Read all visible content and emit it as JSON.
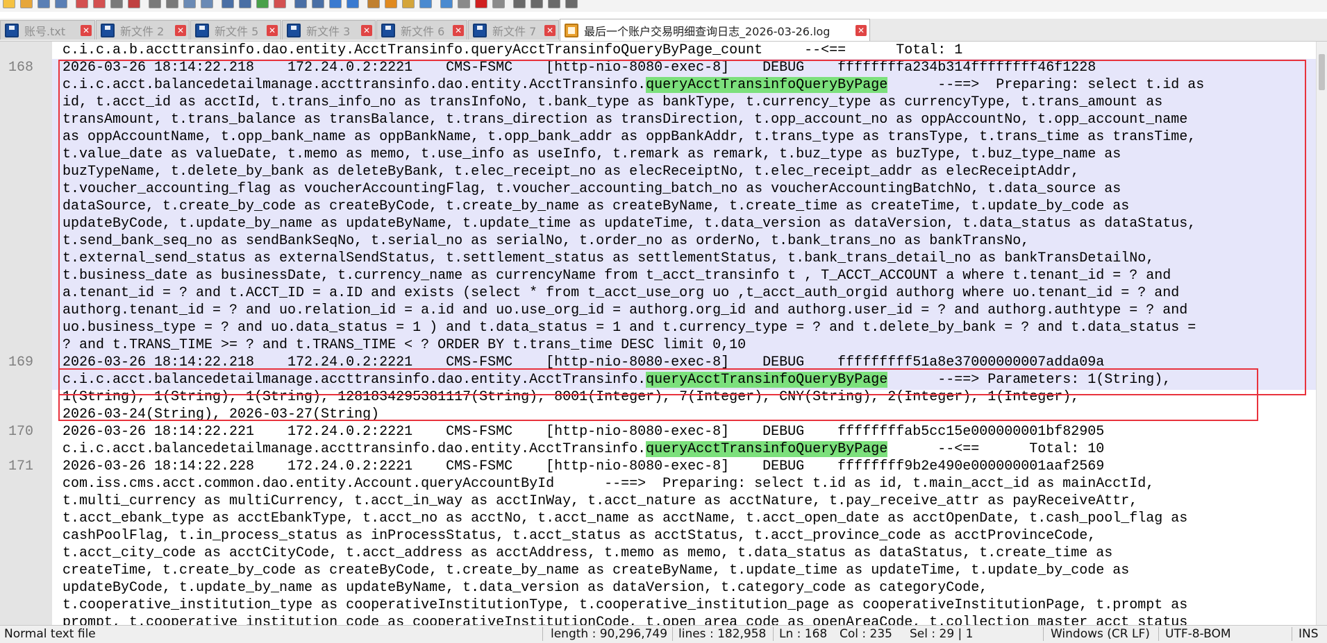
{
  "window": {
    "title": "最后一个账户交易明细查询日志_2026-03-26.log"
  },
  "tabs": [
    {
      "label": "账号.txt",
      "active": false,
      "icon": "save-disk-icon"
    },
    {
      "label": "新文件 2",
      "active": false,
      "icon": "save-disk-icon"
    },
    {
      "label": "新文件 5",
      "active": false,
      "icon": "save-disk-icon"
    },
    {
      "label": "新文件 3",
      "active": false,
      "icon": "save-disk-icon"
    },
    {
      "label": "新文件 6",
      "active": false,
      "icon": "save-disk-icon"
    },
    {
      "label": "新文件 7",
      "active": false,
      "icon": "save-disk-icon"
    },
    {
      "label": "最后一个账户交易明细查询日志_2026-03-26.log",
      "active": true,
      "icon": "unsaved-file-icon"
    }
  ],
  "editor": {
    "highlight_term": "queryAcctTransinfoQueryByPage",
    "lines": [
      {
        "num": "",
        "text": "c.i.c.a.b.accttransinfo.dao.entity.AcctTransinfo.queryAcctTransinfoQueryByPage_count     --<==      Total: 1"
      },
      {
        "num": "168",
        "text": "2026-03-26 18:14:22.218    172.24.0.2:2221    CMS-FSMC    [http-nio-8080-exec-8]    DEBUG    ffffffffa234b314ffffffff46f1228"
      },
      {
        "num": "",
        "text": "c.i.c.acct.balancedetailmanage.accttransinfo.dao.entity.AcctTransinfo.",
        "hl": "queryAcctTransinfoQueryByPage",
        "post": "      --==>  Preparing: select t.id as"
      },
      {
        "num": "",
        "text": "id, t.acct_id as acctId, t.trans_info_no as transInfoNo, t.bank_type as bankType, t.currency_type as currencyType, t.trans_amount as"
      },
      {
        "num": "",
        "text": "transAmount, t.trans_balance as transBalance, t.trans_direction as transDirection, t.opp_account_no as oppAccountNo, t.opp_account_name"
      },
      {
        "num": "",
        "text": "as oppAccountName, t.opp_bank_name as oppBankName, t.opp_bank_addr as oppBankAddr, t.trans_type as transType, t.trans_time as transTime,"
      },
      {
        "num": "",
        "text": "t.value_date as valueDate, t.memo as memo, t.use_info as useInfo, t.remark as remark, t.buz_type as buzType, t.buz_type_name as"
      },
      {
        "num": "",
        "text": "buzTypeName, t.delete_by_bank as deleteByBank, t.elec_receipt_no as elecReceiptNo, t.elec_receipt_addr as elecReceiptAddr,"
      },
      {
        "num": "",
        "text": "t.voucher_accounting_flag as voucherAccountingFlag, t.voucher_accounting_batch_no as voucherAccountingBatchNo, t.data_source as"
      },
      {
        "num": "",
        "text": "dataSource, t.create_by_code as createByCode, t.create_by_name as createByName, t.create_time as createTime, t.update_by_code as"
      },
      {
        "num": "",
        "text": "updateByCode, t.update_by_name as updateByName, t.update_time as updateTime, t.data_version as dataVersion, t.data_status as dataStatus,"
      },
      {
        "num": "",
        "text": "t.send_bank_seq_no as sendBankSeqNo, t.serial_no as serialNo, t.order_no as orderNo, t.bank_trans_no as bankTransNo,"
      },
      {
        "num": "",
        "text": "t.external_send_status as externalSendStatus, t.settlement_status as settlementStatus, t.bank_trans_detail_no as bankTransDetailNo,"
      },
      {
        "num": "",
        "text": "t.business_date as businessDate, t.currency_name as currencyName from t_acct_transinfo t , T_ACCT_ACCOUNT a where t.tenant_id = ? and"
      },
      {
        "num": "",
        "text": "a.tenant_id = ? and t.ACCT_ID = a.ID and exists (select * from t_acct_use_org uo ,t_acct_auth_orgid authorg where uo.tenant_id = ? and"
      },
      {
        "num": "",
        "text": "authorg.tenant_id = ? and uo.relation_id = a.id and uo.use_org_id = authorg.org_id and authorg.user_id = ? and authorg.authtype = ? and"
      },
      {
        "num": "",
        "text": "uo.business_type = ? and uo.data_status = 1 ) and t.data_status = 1 and t.currency_type = ? and t.delete_by_bank = ? and t.data_status ="
      },
      {
        "num": "",
        "text": "? and t.TRANS_TIME >= ? and t.TRANS_TIME < ? ORDER BY t.trans_time DESC limit 0,10"
      },
      {
        "num": "169",
        "text": "2026-03-26 18:14:22.218    172.24.0.2:2221    CMS-FSMC    [http-nio-8080-exec-8]    DEBUG    fffffffff51a8e37000000007adda09a"
      },
      {
        "num": "",
        "text": "c.i.c.acct.balancedetailmanage.accttransinfo.dao.entity.AcctTransinfo.",
        "hl": "queryAcctTransinfoQueryByPage",
        "post": "      --==> Parameters: 1(String),"
      },
      {
        "num": "",
        "text": "1(String), 1(String), 1(String), 1281834295381117(String), 8001(Integer), 7(Integer), CNY(String), 2(Integer), 1(Integer),"
      },
      {
        "num": "",
        "text": "2026-03-24(String), 2026-03-27(String)"
      },
      {
        "num": "170",
        "text": "2026-03-26 18:14:22.221    172.24.0.2:2221    CMS-FSMC    [http-nio-8080-exec-8]    DEBUG    ffffffffab5cc15e000000001bf82905"
      },
      {
        "num": "",
        "text": "c.i.c.acct.balancedetailmanage.accttransinfo.dao.entity.AcctTransinfo.",
        "hl": "queryAcctTransinfoQueryByPage",
        "post": "      --<==      Total: 10"
      },
      {
        "num": "171",
        "text": "2026-03-26 18:14:22.228    172.24.0.2:2221    CMS-FSMC    [http-nio-8080-exec-8]    DEBUG    ffffffff9b2e490e000000001aaf2569"
      },
      {
        "num": "",
        "text": "com.iss.cms.acct.common.dao.entity.Account.queryAccountById      --==>  Preparing: select t.id as id, t.main_acct_id as mainAcctId,"
      },
      {
        "num": "",
        "text": "t.multi_currency as multiCurrency, t.acct_in_way as acctInWay, t.acct_nature as acctNature, t.pay_receive_attr as payReceiveAttr,"
      },
      {
        "num": "",
        "text": "t.acct_ebank_type as acctEbankType, t.acct_no as acctNo, t.acct_name as acctName, t.acct_open_date as acctOpenDate, t.cash_pool_flag as"
      },
      {
        "num": "",
        "text": "cashPoolFlag, t.in_process_status as inProcessStatus, t.acct_status as acctStatus, t.acct_province_code as acctProvinceCode,"
      },
      {
        "num": "",
        "text": "t.acct_city_code as acctCityCode, t.acct_address as acctAddress, t.memo as memo, t.data_status as dataStatus, t.create_time as"
      },
      {
        "num": "",
        "text": "createTime, t.create_by_code as createByCode, t.create_by_name as createByName, t.update_time as updateTime, t.update_by_code as"
      },
      {
        "num": "",
        "text": "updateByCode, t.update_by_name as updateByName, t.data_version as dataVersion, t.category_code as categoryCode,"
      },
      {
        "num": "",
        "text": "t.cooperative_institution_type as cooperativeInstitutionType, t.cooperative_institution_page as cooperativeInstitutionPage, t.prompt as"
      },
      {
        "num": "",
        "text": "prompt, t.cooperative_institution_code as cooperativeInstitutionCode, t.open_area_code as openAreaCode, t.collection_master_acct_status"
      }
    ]
  },
  "statusbar": {
    "file_type": "Normal text file",
    "length": "length : 90,296,749",
    "lines": "lines : 182,958",
    "ln": "Ln : 168",
    "col": "Col : 235",
    "sel": "Sel : 29 | 1",
    "eol": "Windows (CR LF)",
    "encoding": "UTF-8-BOM",
    "mode": "INS"
  },
  "colors": {
    "highlight": "#7ce07c",
    "selection": "#e6e6fa",
    "red_box": "#e8323c",
    "gutter": "#e4e4e4"
  }
}
